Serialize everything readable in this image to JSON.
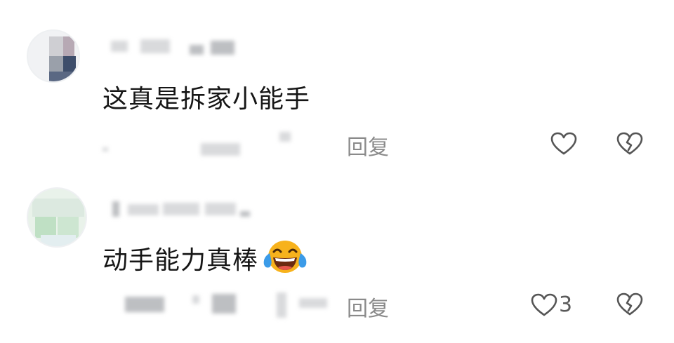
{
  "comments": [
    {
      "text": "这真是拆家小能手",
      "reply_label": "回复",
      "like_count": "",
      "icons": [
        "heart-outline-icon",
        "broken-heart-icon"
      ]
    },
    {
      "text": "动手能力真棒",
      "emoji": "laughing-crying-emoji",
      "reply_label": "回复",
      "like_count": "3",
      "icons": [
        "heart-outline-icon",
        "broken-heart-icon"
      ]
    }
  ],
  "colors": {
    "text": "#161616",
    "meta": "#8a8a8a",
    "icon": "#555555",
    "emoji_face": "#f7b21c",
    "emoji_tear": "#3b9be8"
  }
}
